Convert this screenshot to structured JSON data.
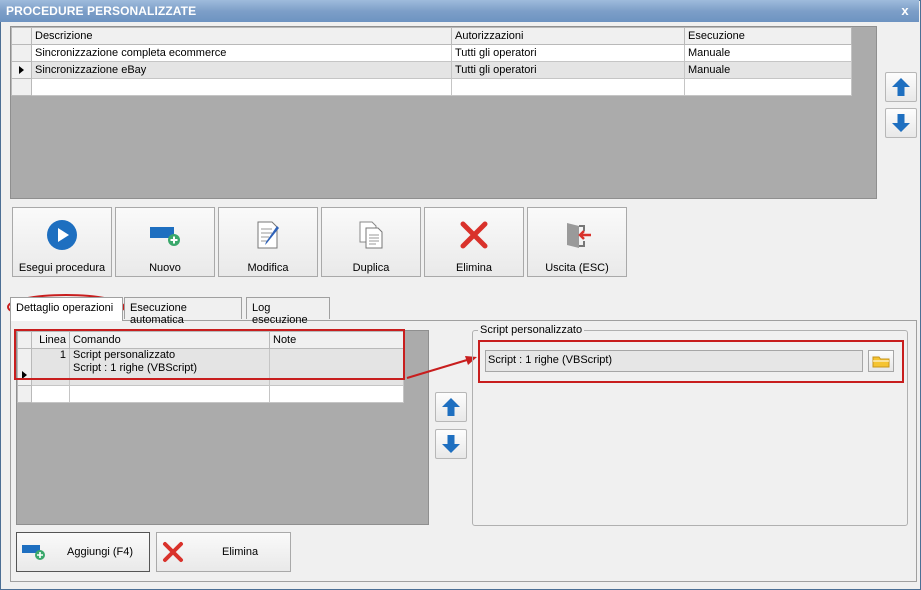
{
  "window": {
    "title": "PROCEDURE PERSONALIZZATE",
    "close_glyph": "x"
  },
  "procedures": {
    "columns": [
      "Descrizione",
      "Autorizzazioni",
      "Esecuzione"
    ],
    "rows": [
      {
        "descrizione": "Sincronizzazione completa ecommerce",
        "autorizzazioni": "Tutti gli operatori",
        "esecuzione": "Manuale"
      },
      {
        "descrizione": "Sincronizzazione eBay",
        "autorizzazioni": "Tutti gli operatori",
        "esecuzione": "Manuale",
        "current": true
      }
    ]
  },
  "toolbar": {
    "run": "Esegui procedura",
    "new": "Nuovo",
    "edit": "Modifica",
    "duplicate": "Duplica",
    "delete": "Elimina",
    "exit": "Uscita (ESC)"
  },
  "tabs": [
    {
      "label": "Dettaglio operazioni",
      "active": true
    },
    {
      "label": "Esecuzione automatica"
    },
    {
      "label": "Log esecuzione"
    }
  ],
  "operations": {
    "columns": [
      "Linea",
      "Comando",
      "Note"
    ],
    "rows": [
      {
        "linea": "1",
        "comando_line1": "Script personalizzato",
        "comando_line2": "Script : 1 righe (VBScript)",
        "note": ""
      }
    ]
  },
  "script_group": {
    "label": "Script personalizzato",
    "value": "Script : 1 righe (VBScript)"
  },
  "bottom": {
    "add": "Aggiungi (F4)",
    "delete": "Elimina"
  },
  "colors": {
    "arrow_blue": "#1e6fc0",
    "delete_red": "#d9322b",
    "highlight_red": "#c81e1e",
    "titlebar": "#7d9fc8"
  },
  "icons": [
    "play-icon",
    "new-item-icon",
    "edit-icon",
    "duplicate-icon",
    "delete-icon",
    "exit-icon",
    "arrow-up-icon",
    "arrow-down-icon",
    "folder-icon"
  ]
}
